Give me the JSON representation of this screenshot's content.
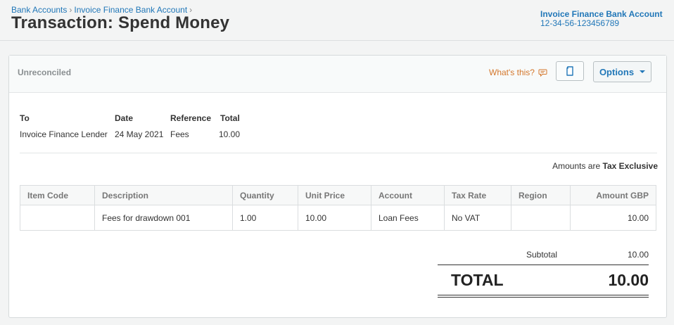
{
  "breadcrumb": {
    "items": [
      "Bank Accounts",
      "Invoice Finance Bank Account"
    ],
    "separator": "›"
  },
  "page": {
    "title": "Transaction: Spend Money"
  },
  "account": {
    "name": "Invoice Finance Bank Account",
    "number": "12-34-56-123456789"
  },
  "panel": {
    "status": "Unreconciled",
    "whats_this": "What's this?",
    "options_label": "Options",
    "icons": {
      "copy": "copy-icon",
      "help": "speech-bubble-icon",
      "dropdown": "caret-down-icon"
    }
  },
  "summary": {
    "to_label": "To",
    "to_value": "Invoice Finance Lender",
    "date_label": "Date",
    "date_value": "24 May 2021",
    "reference_label": "Reference",
    "reference_value": "Fees",
    "total_label": "Total",
    "total_value": "10.00"
  },
  "amounts_note": {
    "prefix": "Amounts are",
    "mode": "Tax Exclusive"
  },
  "line_items": {
    "headers": [
      "Item Code",
      "Description",
      "Quantity",
      "Unit Price",
      "Account",
      "Tax Rate",
      "Region",
      "Amount GBP"
    ],
    "rows": [
      {
        "item_code": "",
        "description": "Fees for drawdown 001",
        "quantity": "1.00",
        "unit_price": "10.00",
        "account": "Loan Fees",
        "tax_rate": "No VAT",
        "region": "",
        "amount": "10.00"
      }
    ]
  },
  "totals": {
    "subtotal_label": "Subtotal",
    "subtotal_value": "10.00",
    "total_label": "TOTAL",
    "total_value": "10.00"
  },
  "colors": {
    "link": "#2177b8",
    "help": "#d4772c",
    "background": "#f3f4f4"
  }
}
